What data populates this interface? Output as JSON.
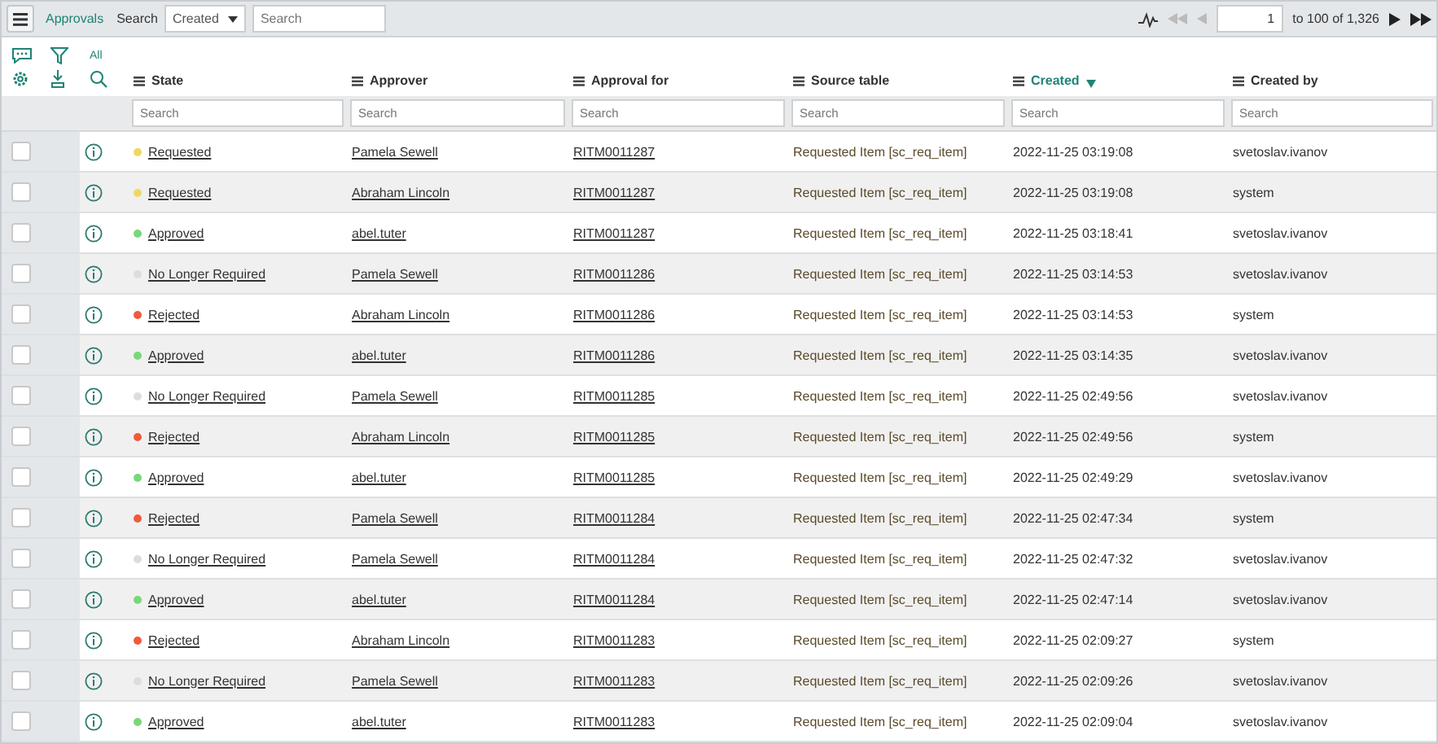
{
  "header": {
    "title": "Approvals",
    "search_label": "Search",
    "search_field": {
      "value": "Created"
    },
    "search": {
      "placeholder": "Search"
    },
    "pager": {
      "page": "1",
      "range": "to 100 of 1,326"
    }
  },
  "toolbar": {
    "filter_label": "All"
  },
  "columns": [
    {
      "label": "State",
      "sorted": false
    },
    {
      "label": "Approver",
      "sorted": false
    },
    {
      "label": "Approval for",
      "sorted": false
    },
    {
      "label": "Source table",
      "sorted": false
    },
    {
      "label": "Created",
      "sorted": true
    },
    {
      "label": "Created by",
      "sorted": false
    }
  ],
  "column_search_placeholder": [
    "Search",
    "Search",
    "Search",
    "Search",
    "Search",
    "Search"
  ],
  "rows": [
    {
      "checked": false,
      "state": "Requested",
      "color": "#f0d860",
      "approver": "Pamela Sewell",
      "approval_for": "RITM0011287",
      "source_table": "Requested Item [sc_req_item]",
      "created": "2022-11-25 03:19:08",
      "created_by": "svetoslav.ivanov"
    },
    {
      "checked": false,
      "state": "Requested",
      "color": "#f0d860",
      "approver": "Abraham Lincoln",
      "approval_for": "RITM0011287",
      "source_table": "Requested Item [sc_req_item]",
      "created": "2022-11-25 03:19:08",
      "created_by": "system"
    },
    {
      "checked": false,
      "state": "Approved",
      "color": "#78d878",
      "approver": "abel.tuter",
      "approval_for": "RITM0011287",
      "source_table": "Requested Item [sc_req_item]",
      "created": "2022-11-25 03:18:41",
      "created_by": "svetoslav.ivanov"
    },
    {
      "checked": false,
      "state": "No Longer Required",
      "color": "#dddddd",
      "approver": "Pamela Sewell",
      "approval_for": "RITM0011286",
      "source_table": "Requested Item [sc_req_item]",
      "created": "2022-11-25 03:14:53",
      "created_by": "svetoslav.ivanov"
    },
    {
      "checked": false,
      "state": "Rejected",
      "color": "#f05a3c",
      "approver": "Abraham Lincoln",
      "approval_for": "RITM0011286",
      "source_table": "Requested Item [sc_req_item]",
      "created": "2022-11-25 03:14:53",
      "created_by": "system"
    },
    {
      "checked": false,
      "state": "Approved",
      "color": "#78d878",
      "approver": "abel.tuter",
      "approval_for": "RITM0011286",
      "source_table": "Requested Item [sc_req_item]",
      "created": "2022-11-25 03:14:35",
      "created_by": "svetoslav.ivanov"
    },
    {
      "checked": false,
      "state": "No Longer Required",
      "color": "#dddddd",
      "approver": "Pamela Sewell",
      "approval_for": "RITM0011285",
      "source_table": "Requested Item [sc_req_item]",
      "created": "2022-11-25 02:49:56",
      "created_by": "svetoslav.ivanov"
    },
    {
      "checked": false,
      "state": "Rejected",
      "color": "#f05a3c",
      "approver": "Abraham Lincoln",
      "approval_for": "RITM0011285",
      "source_table": "Requested Item [sc_req_item]",
      "created": "2022-11-25 02:49:56",
      "created_by": "system"
    },
    {
      "checked": false,
      "state": "Approved",
      "color": "#78d878",
      "approver": "abel.tuter",
      "approval_for": "RITM0011285",
      "source_table": "Requested Item [sc_req_item]",
      "created": "2022-11-25 02:49:29",
      "created_by": "svetoslav.ivanov"
    },
    {
      "checked": false,
      "state": "Rejected",
      "color": "#f05a3c",
      "approver": "Pamela Sewell",
      "approval_for": "RITM0011284",
      "source_table": "Requested Item [sc_req_item]",
      "created": "2022-11-25 02:47:34",
      "created_by": "system"
    },
    {
      "checked": false,
      "state": "No Longer Required",
      "color": "#dddddd",
      "approver": "Pamela Sewell",
      "approval_for": "RITM0011284",
      "source_table": "Requested Item [sc_req_item]",
      "created": "2022-11-25 02:47:32",
      "created_by": "svetoslav.ivanov"
    },
    {
      "checked": false,
      "state": "Approved",
      "color": "#78d878",
      "approver": "abel.tuter",
      "approval_for": "RITM0011284",
      "source_table": "Requested Item [sc_req_item]",
      "created": "2022-11-25 02:47:14",
      "created_by": "svetoslav.ivanov"
    },
    {
      "checked": false,
      "state": "Rejected",
      "color": "#f05a3c",
      "approver": "Abraham Lincoln",
      "approval_for": "RITM0011283",
      "source_table": "Requested Item [sc_req_item]",
      "created": "2022-11-25 02:09:27",
      "created_by": "system"
    },
    {
      "checked": false,
      "state": "No Longer Required",
      "color": "#dddddd",
      "approver": "Pamela Sewell",
      "approval_for": "RITM0011283",
      "source_table": "Requested Item [sc_req_item]",
      "created": "2022-11-25 02:09:26",
      "created_by": "svetoslav.ivanov"
    },
    {
      "checked": false,
      "state": "Approved",
      "color": "#78d878",
      "approver": "abel.tuter",
      "approval_for": "RITM0011283",
      "source_table": "Requested Item [sc_req_item]",
      "created": "2022-11-25 02:09:04",
      "created_by": "svetoslav.ivanov"
    }
  ]
}
